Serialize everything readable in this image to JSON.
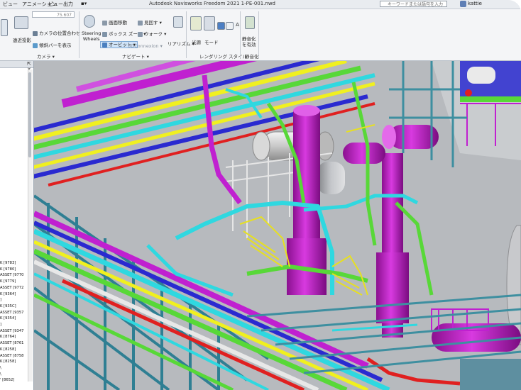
{
  "window": {
    "title": "Autodesk Navisworks Freedom 2021   1-PE-001.nwd",
    "tabs": [
      "ビュー",
      "アニメーション",
      "ビュー",
      "出力"
    ],
    "search_placeholder": "キーワードまたは語句を入力",
    "user": "kattie"
  },
  "ribbon": {
    "camera_group": {
      "label": "カメラ ▾",
      "field_value": "75.607",
      "align_button": "遠近投影",
      "position_button": "カメラの位置合わせ",
      "show_tilt_button": "傾斜バーを表示"
    },
    "navigate_group": {
      "label": "ナビゲート ▾",
      "steering_wheels": "Steering\nWheels",
      "pan": "画面移動",
      "zoom_box": "ボックス ズーム ▾",
      "orbit": "オービット ▾",
      "look": "見回す ▾",
      "walk": "ウォーク ▾",
      "connexion": "3DConnexion ▾",
      "realism": "リアリズム ▾"
    },
    "render_group": {
      "label": "レンダリング スタイル",
      "light": "光源",
      "mode": "モード"
    },
    "static_group": {
      "label": "静音化",
      "enable": "静音化\nを有効"
    }
  },
  "tree": {
    "items": [
      "K [9783]",
      "K [9780]",
      "ASSET [9770",
      "K [9779]",
      "ASSET [9772",
      "K [9364]",
      "]",
      "K [935C]",
      "ASSET [9357",
      "K [9354]",
      "]",
      "ASSET [9347",
      "K [8764]",
      "ASSET [8761",
      "K [8258]",
      "ASSET [8758",
      "K [8258]",
      "\\",
      "\\",
      "' [8652]"
    ]
  },
  "colors": {
    "magenta": "#c020d0",
    "cyan": "#2fd8e0",
    "green": "#58d838",
    "yellow": "#f0f020",
    "steel": "#3e8fa0",
    "blue": "#2a2ad0",
    "red": "#e02020"
  }
}
